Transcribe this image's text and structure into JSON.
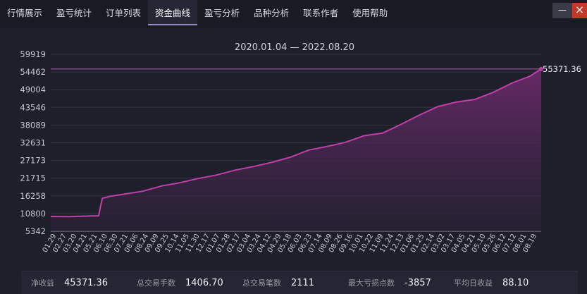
{
  "tabs": [
    {
      "label": "行情展示"
    },
    {
      "label": "盈亏统计"
    },
    {
      "label": "订单列表"
    },
    {
      "label": "资金曲线"
    },
    {
      "label": "盈亏分析"
    },
    {
      "label": "品种分析"
    },
    {
      "label": "联系作者"
    },
    {
      "label": "使用帮助"
    }
  ],
  "active_tab_index": 3,
  "window": {
    "min_label": "—",
    "close_label": "×"
  },
  "colors": {
    "line": "#c040a8",
    "fill_top": "#6a2a6a",
    "max_line": "#b05fb0",
    "grid": "#323343",
    "axis_text": "#c8c8d0"
  },
  "chart_data": {
    "type": "area",
    "title": "2020.01.04 — 2022.08.20",
    "xlabel": "",
    "ylabel": "",
    "y_ticks": [
      5342,
      10800,
      16258,
      21715,
      27173,
      32631,
      38089,
      43546,
      49004,
      54462,
      59919
    ],
    "ylim": [
      5342,
      59919
    ],
    "x_tick_labels": [
      "01.29",
      "02.27",
      "03.20",
      "04.21",
      "05.21",
      "06.10",
      "06.30",
      "07.21",
      "08.06",
      "08.24",
      "09.09",
      "09.25",
      "10.14",
      "11.05",
      "11.30",
      "12.17",
      "01.07",
      "01.28",
      "02.17",
      "03.04",
      "03.24",
      "04.12",
      "04.29",
      "05.18",
      "06.03",
      "06.23",
      "07.14",
      "08.09",
      "08.26",
      "09.16",
      "10.01",
      "10.22",
      "11.09",
      "11.24",
      "12.13",
      "01.06",
      "01.25",
      "02.14",
      "03.02",
      "03.17",
      "04.05",
      "04.21",
      "05.10",
      "05.26",
      "06.12",
      "07.12",
      "08.01",
      "08.19"
    ],
    "max_value": 55371.36,
    "max_label": "55371.36",
    "grid": true,
    "points": [
      [
        0,
        9900
      ],
      [
        0.05,
        9850
      ],
      [
        0.08,
        9950
      ],
      [
        0.11,
        10050
      ],
      [
        0.13,
        10100
      ],
      [
        0.135,
        13000
      ],
      [
        0.14,
        15500
      ],
      [
        0.16,
        16100
      ],
      [
        0.2,
        16800
      ],
      [
        0.25,
        17700
      ],
      [
        0.3,
        19300
      ],
      [
        0.35,
        20300
      ],
      [
        0.4,
        21600
      ],
      [
        0.45,
        22700
      ],
      [
        0.5,
        24200
      ],
      [
        0.55,
        25300
      ],
      [
        0.6,
        26600
      ],
      [
        0.65,
        28200
      ],
      [
        0.7,
        30400
      ],
      [
        0.75,
        31500
      ],
      [
        0.8,
        32800
      ],
      [
        0.85,
        34800
      ],
      [
        0.9,
        35600
      ],
      [
        0.95,
        38300
      ],
      [
        1.0,
        41200
      ],
      [
        1.05,
        43800
      ],
      [
        1.1,
        45200
      ],
      [
        1.15,
        46000
      ],
      [
        1.2,
        48200
      ],
      [
        1.25,
        51000
      ],
      [
        1.3,
        53200
      ],
      [
        1.33,
        55371.36
      ]
    ]
  },
  "stats": [
    {
      "label": "净收益",
      "value": "45371.36"
    },
    {
      "label": "总交易手数",
      "value": "1406.70"
    },
    {
      "label": "总交易笔数",
      "value": "2111"
    },
    {
      "label": "最大亏损点数",
      "value": "-3857"
    },
    {
      "label": "平均日收益",
      "value": "88.10"
    }
  ]
}
